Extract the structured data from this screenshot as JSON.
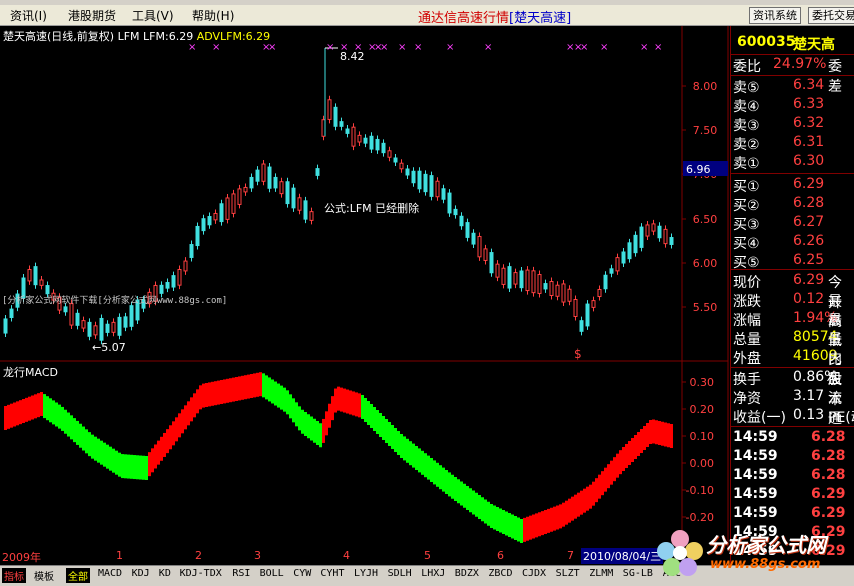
{
  "menubar": {
    "items": [
      "资讯(I)",
      "港股期货",
      "工具(V)",
      "帮助(H)"
    ],
    "title_main": "通达信高速行情",
    "title_stock": "[楚天高速]",
    "btn_news": "资讯系统",
    "btn_trade": "委托交易"
  },
  "chart": {
    "title_stock": "楚天高速(日线,前复权)",
    "title_ind": "LFM",
    "title_lfm": "LFM:6.29",
    "title_adv": "ADVLFM:6.29",
    "note": "公式:LFM 已经删除",
    "max_label": "8.42",
    "min_label": "←5.07",
    "banner": "[分析家公式网软件下载[分析家公式网www.88gs.com]",
    "s_mark": "$",
    "current_price_tag": "6.96",
    "price_axis": [
      "8.00",
      "7.50",
      "7.00",
      "6.50",
      "6.00",
      "5.50"
    ],
    "colors": {
      "up": "#ff4040",
      "down": "#40e0e0",
      "axis": "#800000",
      "macd_pos": "#ff0000",
      "macd_neg": "#00ff00"
    }
  },
  "macd": {
    "title": "龙行MACD",
    "axis": [
      "0.30",
      "0.20",
      "0.10",
      "0.00",
      "-0.10",
      "-0.20"
    ]
  },
  "timeaxis": {
    "labels": [
      "2009年",
      "1",
      "2",
      "3",
      "4",
      "5",
      "6",
      "7"
    ],
    "cursor_date": "2010/08/04/三"
  },
  "quote": {
    "code": "600035",
    "name": "楚天高",
    "wb_label": "委比",
    "wb_val": "24.97%",
    "wc_label": "委差",
    "sells": [
      {
        "label": "卖⑤",
        "price": "6.34"
      },
      {
        "label": "卖④",
        "price": "6.33"
      },
      {
        "label": "卖③",
        "price": "6.32"
      },
      {
        "label": "卖②",
        "price": "6.31"
      },
      {
        "label": "卖①",
        "price": "6.30"
      }
    ],
    "buys": [
      {
        "label": "买①",
        "price": "6.29"
      },
      {
        "label": "买②",
        "price": "6.28"
      },
      {
        "label": "买③",
        "price": "6.27"
      },
      {
        "label": "买④",
        "price": "6.26"
      },
      {
        "label": "买⑤",
        "price": "6.25"
      }
    ],
    "stats": [
      {
        "label": "现价",
        "val": "6.29",
        "lab2": "今开"
      },
      {
        "label": "涨跌",
        "val": "0.12",
        "lab2": "最高"
      },
      {
        "label": "涨幅",
        "val": "1.94%",
        "lab2": "最低"
      },
      {
        "label": "总量",
        "val": "80574",
        "lab2": "量比"
      },
      {
        "label": "外盘",
        "val": "41609",
        "lab2": "内盘"
      }
    ],
    "fin": [
      {
        "label": "换手",
        "val": "0.86%",
        "lab2": "股本"
      },
      {
        "label": "净资",
        "val": "3.17",
        "lab2": "流通"
      },
      {
        "label": "收益(一)",
        "val": "0.13",
        "lab2": "PE(动"
      }
    ],
    "ticks": [
      {
        "time": "14:59",
        "price": "6.28"
      },
      {
        "time": "14:59",
        "price": "6.28"
      },
      {
        "time": "14:59",
        "price": "6.28"
      },
      {
        "time": "14:59",
        "price": "6.29"
      },
      {
        "time": "14:59",
        "price": "6.29"
      },
      {
        "time": "14:59",
        "price": "6.29"
      },
      {
        "time": "14:59",
        "price": "6.29"
      }
    ]
  },
  "tabs": [
    "指标",
    "模板",
    "全部",
    "MACD",
    "KDJ",
    "KD",
    "KDJ-TDX",
    "RSI",
    "BOLL",
    "CYW",
    "CYHT",
    "LYJH",
    "SDLH",
    "LHXJ",
    "BDZX",
    "ZBCD",
    "CJDX",
    "SLZT",
    "ZLMM",
    "SG-LB",
    "ACC"
  ],
  "watermark": {
    "name": "分析家公式网",
    "url": "www.88gs.com"
  }
}
